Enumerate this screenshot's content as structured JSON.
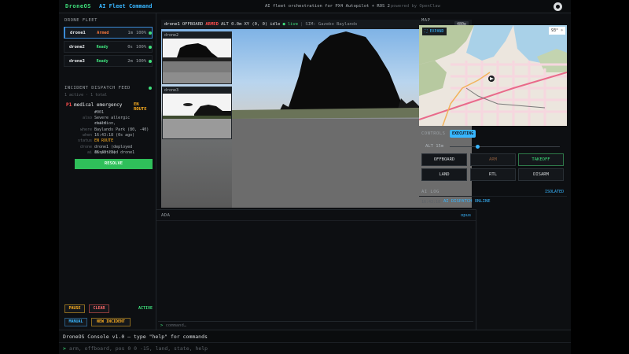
{
  "header": {
    "logo": "DroneOS",
    "title": "AI Fleet Command",
    "subtitle": "AI fleet orchestration for PX4 Autopilot + ROS 2",
    "powered": "powered by OpenClaw"
  },
  "fleet": {
    "heading": "DRONE FLEET",
    "drones": [
      {
        "name": "drone1",
        "status": "Armed",
        "status_color": "#ff7a3d",
        "time": "1m",
        "battery": "100%"
      },
      {
        "name": "drone2",
        "status": "Ready",
        "status_color": "#3fe07c",
        "time": "0s",
        "battery": "100%"
      },
      {
        "name": "drone3",
        "status": "Ready",
        "status_color": "#3fe07c",
        "time": "2m",
        "battery": "100%"
      }
    ]
  },
  "feed": {
    "heading": "INCIDENT DISPATCH FEED",
    "summary": "1 active · 1 total",
    "incident": {
      "priority": "P1",
      "title": "medical emergency",
      "state": "EN ROUTE",
      "rows": [
        {
          "k": "",
          "v": "#001"
        },
        {
          "k": "also",
          "v": "Severe allergic reaction,"
        },
        {
          "k": "",
          "v": "child"
        },
        {
          "k": "where",
          "v": "Baylands Park (80, -40)"
        },
        {
          "k": "when",
          "v": "16:43:18 (0s ago)"
        },
        {
          "k": "status",
          "v": "EN ROUTE"
        },
        {
          "k": "drone",
          "v": "drone1 (deployed 16:43:22)"
        },
        {
          "k": "ai",
          "v": "dispatched drone1"
        }
      ],
      "resolve_label": "RESOLVE"
    },
    "pause_label": "PAUSE",
    "clear_label": "CLEAR",
    "active_label": "ACTIVE",
    "manual_label": "MANUAL",
    "new_incident_label": "NEW INCIDENT"
  },
  "video": {
    "drone": "drone1",
    "mode": "OFFBOARD",
    "armed": "ARMED",
    "alt": "ALT 0.0m",
    "xy": "XY (0, 0)",
    "state": "idle",
    "live": "live",
    "sim": "SIM: Gazebo Baylands",
    "resolution": "480p",
    "pips": [
      "drone2",
      "drone3"
    ]
  },
  "ada": {
    "heading": "ADA",
    "model": "opus",
    "prompt": ">",
    "placeholder": "command…"
  },
  "map": {
    "heading": "MAP",
    "expand_label": "⛶ EXPAND",
    "temp": "93° ☼"
  },
  "controls": {
    "heading": "CONTROLS",
    "badge": "EXECUTING",
    "alt_label": "ALT 15m",
    "alt_value_m": 15,
    "buttons": [
      {
        "label": "OFFBOARD",
        "color": "#d7dadc",
        "border": "#2a3036"
      },
      {
        "label": "ARM",
        "color": "#8a5a3c",
        "border": "#2a3036"
      },
      {
        "label": "TAKEOFF",
        "color": "#3fe07c",
        "border": "#2f7a4a"
      },
      {
        "label": "LAND",
        "color": "#d7dadc",
        "border": "#2a3036"
      },
      {
        "label": "RTL",
        "color": "#d7dadc",
        "border": "#2a3036"
      },
      {
        "label": "DISARM",
        "color": "#d7dadc",
        "border": "#2a3036"
      }
    ]
  },
  "ailog": {
    "heading": "AI LOG",
    "badge": "ISOLATED",
    "entries": [
      {
        "ts": "16:43:18",
        "msg": "AI DISPATCH ONLINE"
      }
    ]
  },
  "console": {
    "title": "DroneOS Console v1.0 — type \"help\" for commands",
    "prompt": ">",
    "placeholder": "arm, offboard, pos 0 0 -15, land, state, help"
  }
}
